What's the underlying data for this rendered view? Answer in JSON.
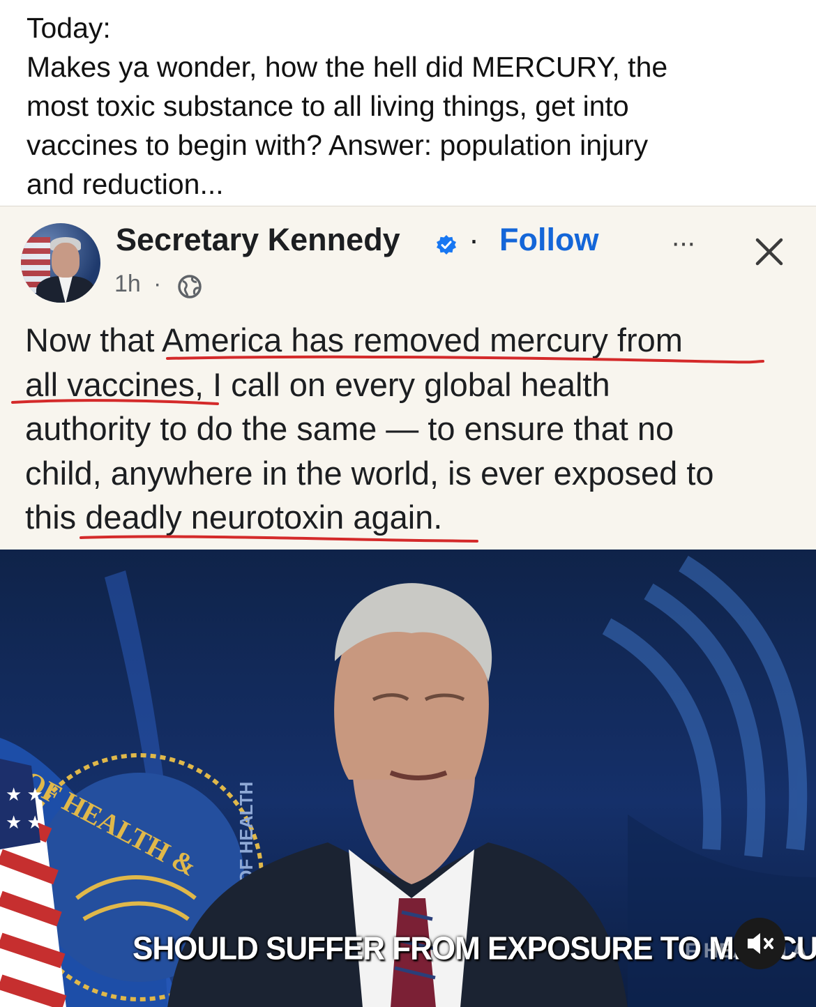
{
  "caption": {
    "lines": [
      "Today:",
      "Makes ya wonder, how the hell did MERCURY, the",
      "most toxic substance to all living things, get into",
      "vaccines to begin with? Answer: population injury",
      "and reduction..."
    ]
  },
  "post": {
    "author": "Secretary Kennedy",
    "separator": "·",
    "follow_label": "Follow",
    "more_label": "···",
    "timestamp": "1h",
    "time_separator": "·",
    "body_lines": [
      "Now that America has removed mercury from",
      "all vaccines, I call on every global health",
      "authority to do the same — to ensure that no",
      "child, anywhere in the world, is ever exposed to",
      "this deadly neurotoxin again."
    ],
    "icons": {
      "verified": "verified-badge-icon",
      "more": "more-options-icon",
      "close": "close-icon",
      "privacy": "globe-icon"
    }
  },
  "video": {
    "subtitle": "SHOULD SUFFER FROM EXPOSURE TO MERCURY.",
    "watermark": "F HEALTH A",
    "seal_text": "OF HEALTH &",
    "wall_text": "S DEPARTMENT OF HEALTH",
    "mute_icon": "muted-speaker-icon"
  },
  "colors": {
    "follow": "#1466d8",
    "underline": "#d42a2a",
    "card_bg": "#f8f5ee",
    "verified": "#1877f2"
  }
}
